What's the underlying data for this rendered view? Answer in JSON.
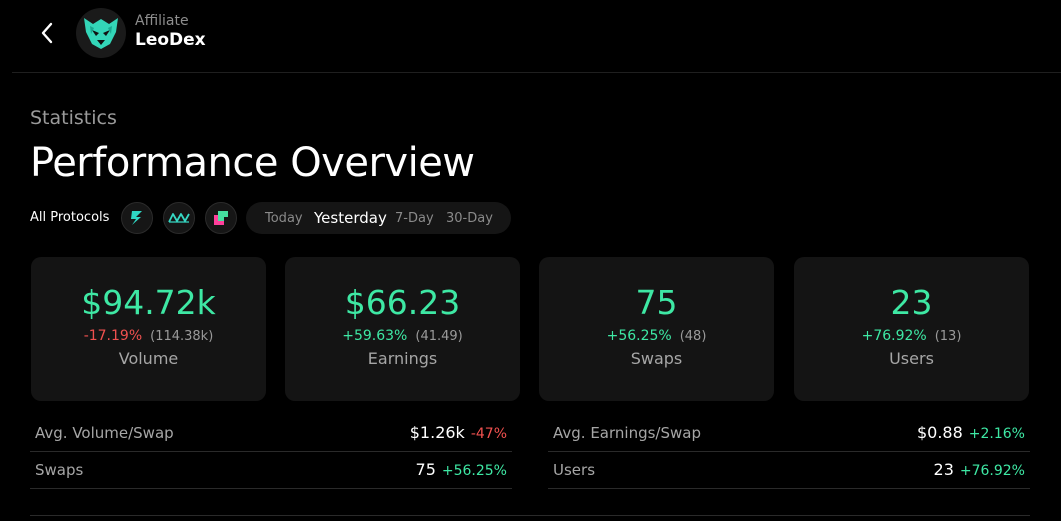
{
  "header": {
    "back_icon": "chevron-left-icon",
    "logo_icon": "lion-logo-icon",
    "affiliate_label": "Affiliate",
    "name": "LeoDex"
  },
  "page": {
    "subtitle": "Statistics",
    "title": "Performance Overview"
  },
  "filters": {
    "protocols_label": "All Protocols",
    "protocol_icons": [
      "thorchain-icon",
      "maya-icon",
      "chainflip-icon"
    ],
    "ranges": [
      "Today",
      "Yesterday",
      "7-Day",
      "30-Day"
    ],
    "active_range": "Yesterday"
  },
  "cards": [
    {
      "value": "$94.72k",
      "change": "-17.19%",
      "previous": "(114.38k)",
      "label": "Volume"
    },
    {
      "value": "$66.23",
      "change": "+59.63%",
      "previous": "(41.49)",
      "label": "Earnings"
    },
    {
      "value": "75",
      "change": "+56.25%",
      "previous": "(48)",
      "label": "Swaps"
    },
    {
      "value": "23",
      "change": "+76.92%",
      "previous": "(13)",
      "label": "Users"
    }
  ],
  "rows": [
    {
      "label": "Avg. Volume/Swap",
      "value": "$1.26k",
      "change": "-47%"
    },
    {
      "label": "Avg. Earnings/Swap",
      "value": "$0.88",
      "change": "+2.16%"
    },
    {
      "label": "Swaps",
      "value": "75",
      "change": "+56.25%"
    },
    {
      "label": "Users",
      "value": "23",
      "change": "+76.92%"
    }
  ],
  "colors": {
    "positive": "#3ee8a4",
    "negative": "#f0514f",
    "card_bg": "#141414",
    "background": "#000000"
  }
}
